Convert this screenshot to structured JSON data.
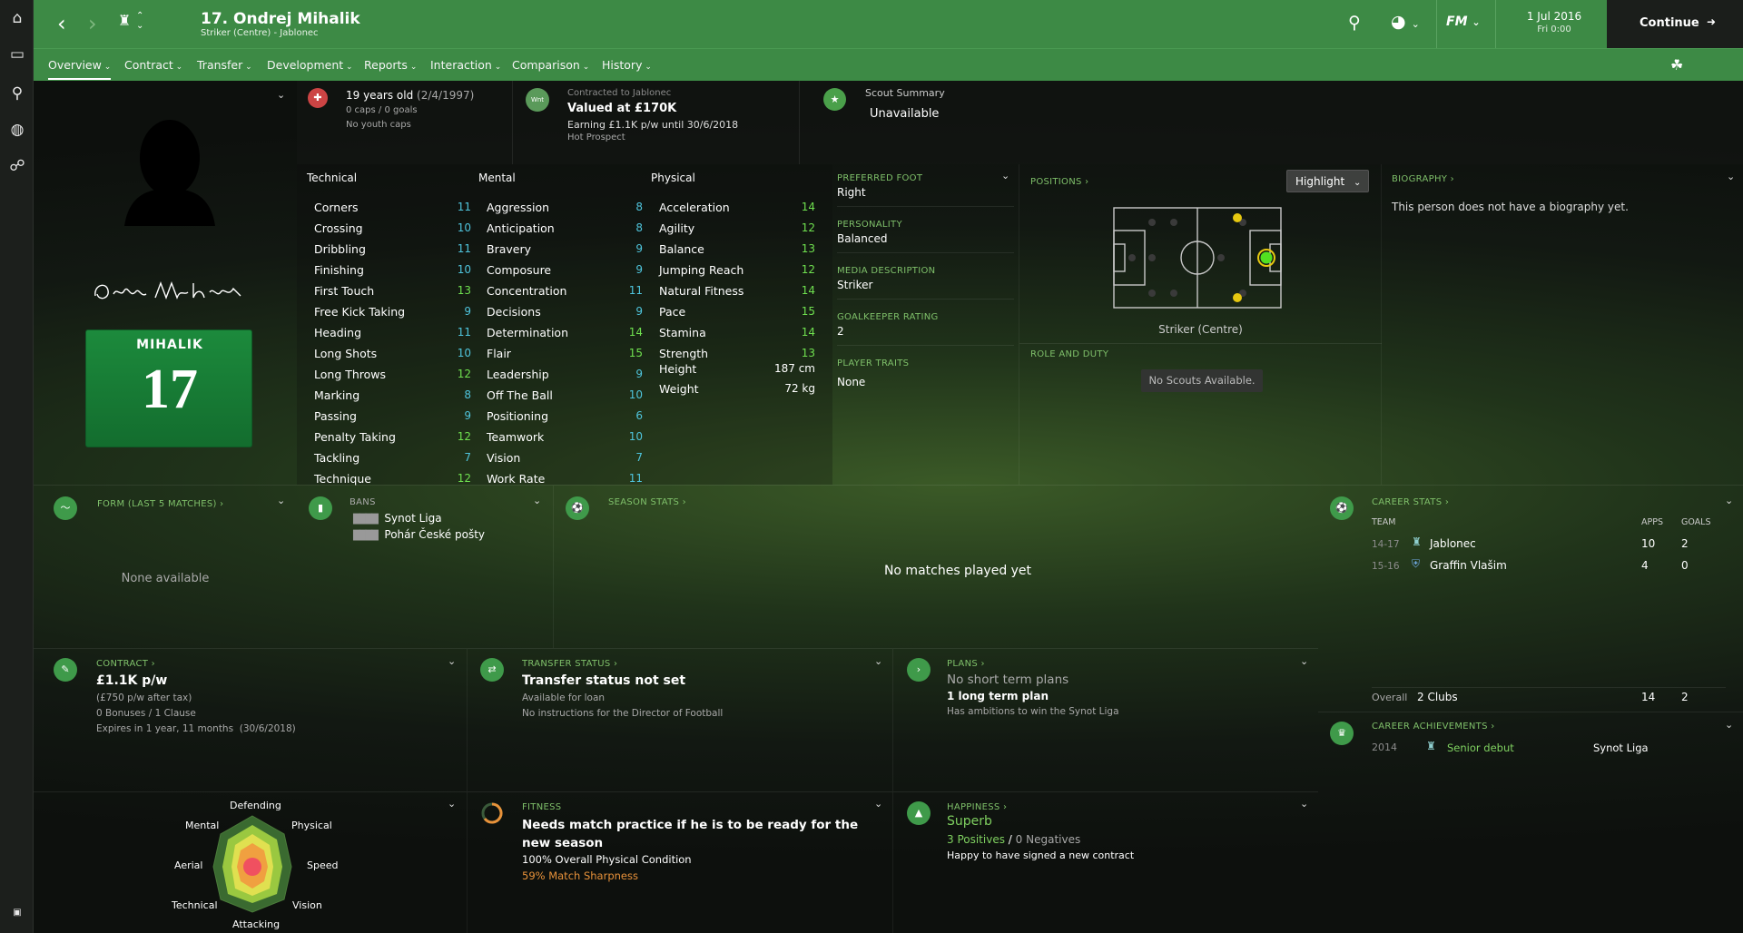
{
  "header": {
    "number_name": "17. Ondrej Mihalik",
    "subtitle": "Striker (Centre) - Jablonec",
    "date": "1 Jul 2016",
    "time": "Fri 0:00",
    "continue": "Continue"
  },
  "nav": [
    "Overview",
    "Contract",
    "Transfer",
    "Development",
    "Reports",
    "Interaction",
    "Comparison",
    "History"
  ],
  "player": {
    "shirt_name": "MIHALIK",
    "shirt_number": "17"
  },
  "info": {
    "age": "19 years old",
    "dob": "(2/4/1997)",
    "caps": "0 caps / 0 goals",
    "youth": "No youth caps",
    "contract_label": "Contracted to Jablonec",
    "value": "Valued at £170K",
    "earning": "Earning £1.1K p/w until 30/6/2018",
    "prospect": "Hot Prospect",
    "wnt": "Wnt",
    "scout_label": "Scout Summary",
    "scout_value": "Unavailable"
  },
  "attributes": {
    "technical_title": "Technical",
    "mental_title": "Mental",
    "physical_title": "Physical",
    "technical": [
      [
        "Corners",
        "11"
      ],
      [
        "Crossing",
        "10"
      ],
      [
        "Dribbling",
        "11"
      ],
      [
        "Finishing",
        "10"
      ],
      [
        "First Touch",
        "13"
      ],
      [
        "Free Kick Taking",
        "9"
      ],
      [
        "Heading",
        "11"
      ],
      [
        "Long Shots",
        "10"
      ],
      [
        "Long Throws",
        "12"
      ],
      [
        "Marking",
        "8"
      ],
      [
        "Passing",
        "9"
      ],
      [
        "Penalty Taking",
        "12"
      ],
      [
        "Tackling",
        "7"
      ],
      [
        "Technique",
        "12"
      ]
    ],
    "mental": [
      [
        "Aggression",
        "8"
      ],
      [
        "Anticipation",
        "8"
      ],
      [
        "Bravery",
        "9"
      ],
      [
        "Composure",
        "9"
      ],
      [
        "Concentration",
        "11"
      ],
      [
        "Decisions",
        "9"
      ],
      [
        "Determination",
        "14"
      ],
      [
        "Flair",
        "15"
      ],
      [
        "Leadership",
        "9"
      ],
      [
        "Off The Ball",
        "10"
      ],
      [
        "Positioning",
        "6"
      ],
      [
        "Teamwork",
        "10"
      ],
      [
        "Vision",
        "7"
      ],
      [
        "Work Rate",
        "11"
      ]
    ],
    "physical": [
      [
        "Acceleration",
        "14"
      ],
      [
        "Agility",
        "12"
      ],
      [
        "Balance",
        "13"
      ],
      [
        "Jumping Reach",
        "12"
      ],
      [
        "Natural Fitness",
        "14"
      ],
      [
        "Pace",
        "15"
      ],
      [
        "Stamina",
        "14"
      ],
      [
        "Strength",
        "13"
      ]
    ],
    "height_label": "Height",
    "height": "187 cm",
    "weight_label": "Weight",
    "weight": "72 kg"
  },
  "details": {
    "foot_label": "PREFERRED FOOT",
    "foot": "Right",
    "personality_label": "PERSONALITY",
    "personality": "Balanced",
    "media_label": "MEDIA DESCRIPTION",
    "media": "Striker",
    "gk_label": "GOALKEEPER RATING",
    "gk": "2",
    "traits_label": "PLAYER TRAITS",
    "traits": "None"
  },
  "positions": {
    "title": "POSITIONS",
    "highlight": "Highlight",
    "position": "Striker (Centre)",
    "role_title": "ROLE AND DUTY",
    "no_scouts": "No Scouts Available."
  },
  "biography": {
    "title": "BIOGRAPHY",
    "text": "This person does not have a biography yet."
  },
  "form": {
    "title": "FORM (LAST 5 MATCHES)",
    "empty": "None available"
  },
  "bans": {
    "title": "BANS",
    "items": [
      "Synot Liga",
      "Pohár České pošty"
    ]
  },
  "season": {
    "title": "SEASON STATS",
    "empty": "No matches played yet"
  },
  "career": {
    "title": "CAREER STATS",
    "col_team": "TEAM",
    "col_apps": "APPS",
    "col_goals": "GOALS",
    "rows": [
      {
        "season": "14-17",
        "team": "Jablonec",
        "apps": "10",
        "goals": "2"
      },
      {
        "season": "15-16",
        "team": "Graffin Vlašim",
        "apps": "4",
        "goals": "0"
      }
    ],
    "overall_label": "Overall",
    "overall_clubs": "2 Clubs",
    "overall_apps": "14",
    "overall_goals": "2"
  },
  "achievements": {
    "title": "CAREER ACHIEVEMENTS",
    "year": "2014",
    "name": "Senior debut",
    "comp": "Synot Liga"
  },
  "contract": {
    "title": "CONTRACT",
    "wage": "£1.1K p/w",
    "after_tax": "(£750 p/w after tax)",
    "bonuses": "0 Bonuses / 1 Clause",
    "expires": "Expires in 1 year, 11 months  (30/6/2018)"
  },
  "transfer": {
    "title": "TRANSFER STATUS",
    "status": "Transfer status not set",
    "loan": "Available for loan",
    "dof": "No instructions for the Director of Football"
  },
  "plans": {
    "title": "PLANS",
    "short": "No short term plans",
    "long": "1 long term plan",
    "ambition": "Has ambitions to win the Synot Liga"
  },
  "radar": {
    "labels": [
      "Defending",
      "Physical",
      "Speed",
      "Vision",
      "Attacking",
      "Technical",
      "Aerial",
      "Mental"
    ]
  },
  "fitness": {
    "title": "FITNESS",
    "need": "Needs match practice if he is to be ready for the new season",
    "condition": "100% Overall Physical Condition",
    "sharpness": "59% Match Sharpness"
  },
  "happiness": {
    "title": "HAPPINESS",
    "level": "Superb",
    "positives": "3 Positives",
    "sep": "/",
    "negatives": "0 Negatives",
    "note": "Happy to have signed a new contract"
  },
  "colors": {
    "header": "#3d8a45",
    "accent": "#7fc06a",
    "teal": "#4fc4dc",
    "green_val": "#6fe04f",
    "orange": "#e8923a"
  }
}
